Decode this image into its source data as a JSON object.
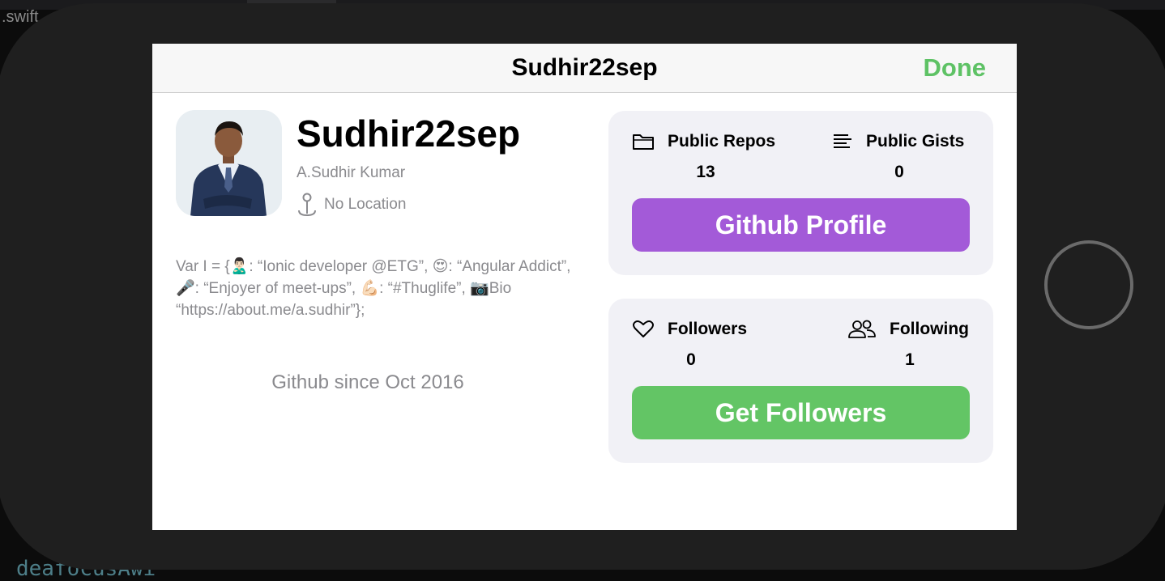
{
  "background": {
    "ide_file_label": ".swift",
    "code_line": "deafocusAwi"
  },
  "nav": {
    "title": "Sudhir22sep",
    "done_label": "Done"
  },
  "profile": {
    "username": "Sudhir22sep",
    "full_name": "A.Sudhir Kumar",
    "location": "No Location",
    "bio": "Var I = {🙎🏻‍♂️: “Ionic developer @ETG”, 😍: “Angular Addict”, 🎤: “Enjoyer of meet-ups”, 💪🏻: “#Thuglife”, 📷Bio “https://about.me/a.sudhir”};",
    "member_since": "Github since Oct 2016"
  },
  "repo_card": {
    "public_repos_label": "Public Repos",
    "public_repos_count": "13",
    "public_gists_label": "Public Gists",
    "public_gists_count": "0",
    "button_label": "Github Profile"
  },
  "follow_card": {
    "followers_label": "Followers",
    "followers_count": "0",
    "following_label": "Following",
    "following_count": "1",
    "button_label": "Get Followers"
  },
  "colors": {
    "accent_green": "#63c565",
    "accent_purple": "#a35ad8",
    "done_green": "#5ec265",
    "secondary_text": "#8a8a8e",
    "card_bg": "#f1f1f6"
  },
  "icons": [
    "folder-icon",
    "text-lines-icon",
    "heart-icon",
    "two-people-icon",
    "map-pin-icon"
  ]
}
